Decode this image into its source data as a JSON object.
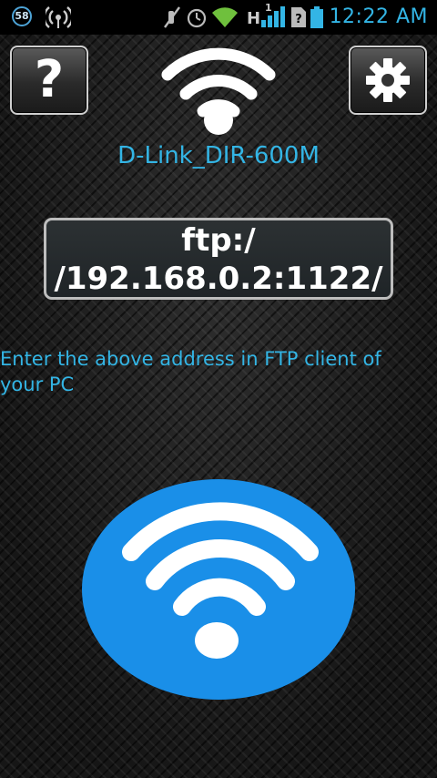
{
  "status_bar": {
    "notification_count": "58",
    "network_type": "H",
    "signal_badge": "1",
    "time": "12:22 AM",
    "icons": [
      "notification-badge-icon",
      "hotspot-icon",
      "mute-icon",
      "alarm-icon",
      "wifi-icon",
      "signal-icon",
      "no-sim-icon",
      "battery-icon"
    ]
  },
  "header": {
    "help_label": "?",
    "network_name": "D-Link_DIR-600M"
  },
  "address": {
    "line1": "ftp:/",
    "line2": "/192.168.0.2:1122/"
  },
  "instruction": "Enter the above address in FTP client of your PC",
  "colors": {
    "accent": "#33b5e5",
    "big_button": "#1a8fe8"
  }
}
